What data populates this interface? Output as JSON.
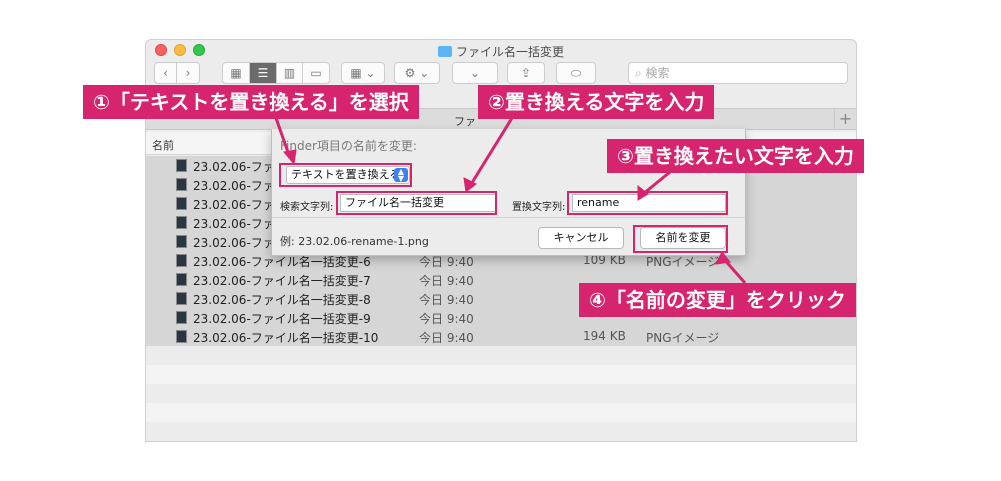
{
  "window": {
    "title": "ファイル名一括変更",
    "search_placeholder": "検索",
    "tab_label": "ファ",
    "tab_add": "+",
    "column_name": "名前",
    "nav_back": "‹",
    "nav_forward": "›"
  },
  "files": [
    {
      "name": "23.02.06-ファ",
      "date": "",
      "size": "",
      "kind": ""
    },
    {
      "name": "23.02.06-ファ",
      "date": "",
      "size": "",
      "kind": ""
    },
    {
      "name": "23.02.06-ファ",
      "date": "",
      "size": "",
      "kind": ""
    },
    {
      "name": "23.02.06-ファ",
      "date": "",
      "size": "",
      "kind": ""
    },
    {
      "name": "23.02.06-ファ",
      "date": "",
      "size": "",
      "kind": ""
    },
    {
      "name": "23.02.06-ファイル名一括変更-6",
      "date": "今日 9:40",
      "size": "109 KB",
      "kind": "PNGイメージ"
    },
    {
      "name": "23.02.06-ファイル名一括変更-7",
      "date": "今日 9:40",
      "size": "",
      "kind": ""
    },
    {
      "name": "23.02.06-ファイル名一括変更-8",
      "date": "今日 9:40",
      "size": "",
      "kind": ""
    },
    {
      "name": "23.02.06-ファイル名一括変更-9",
      "date": "今日 9:40",
      "size": "",
      "kind": ""
    },
    {
      "name": "23.02.06-ファイル名一括変更-10",
      "date": "今日 9:40",
      "size": "194 KB",
      "kind": "PNGイメージ"
    }
  ],
  "dialog": {
    "title": "Finder項目の名前を変更:",
    "mode_select": "テキストを置き換える",
    "find_label": "検索文字列:",
    "find_value": "ファイル名一括変更",
    "replace_label": "置換文字列:",
    "replace_value": "rename",
    "example": "例: 23.02.06-rename-1.png",
    "cancel_label": "キャンセル",
    "rename_label": "名前を変更"
  },
  "callouts": {
    "step1": "①「テキストを置き換える」を選択",
    "step2": "②置き換える文字を入力",
    "step3": "③置き換えたい文字を入力",
    "step4": "④「名前の変更」をクリック"
  },
  "colors": {
    "accent": "#d6246e"
  }
}
